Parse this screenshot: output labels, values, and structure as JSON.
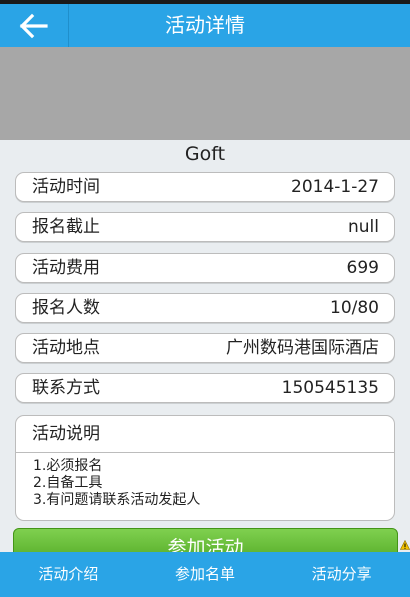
{
  "header": {
    "title": "活动详情",
    "back_icon": "arrow-left-icon"
  },
  "activity": {
    "name": "Goft"
  },
  "details": [
    {
      "label": "活动时间",
      "value": "2014-1-27"
    },
    {
      "label": "报名截止",
      "value": "null"
    },
    {
      "label": "活动费用",
      "value": "699"
    },
    {
      "label": "报名人数",
      "value": "10/80"
    },
    {
      "label": "活动地点",
      "value": "广州数码港国际酒店"
    },
    {
      "label": "联系方式",
      "value": "150545135"
    }
  ],
  "description": {
    "title": "活动说明",
    "lines": [
      "1.必须报名",
      "2.自备工具",
      "3.有问题请联系活动发起人"
    ]
  },
  "join_button": {
    "label": "参加活动"
  },
  "bottom_tabs": [
    "活动介绍",
    "参加名单",
    "活动分享"
  ],
  "colors": {
    "header": "#2aa4e6",
    "join_button": "#5cb82e",
    "banner": "#a7a7a7"
  }
}
